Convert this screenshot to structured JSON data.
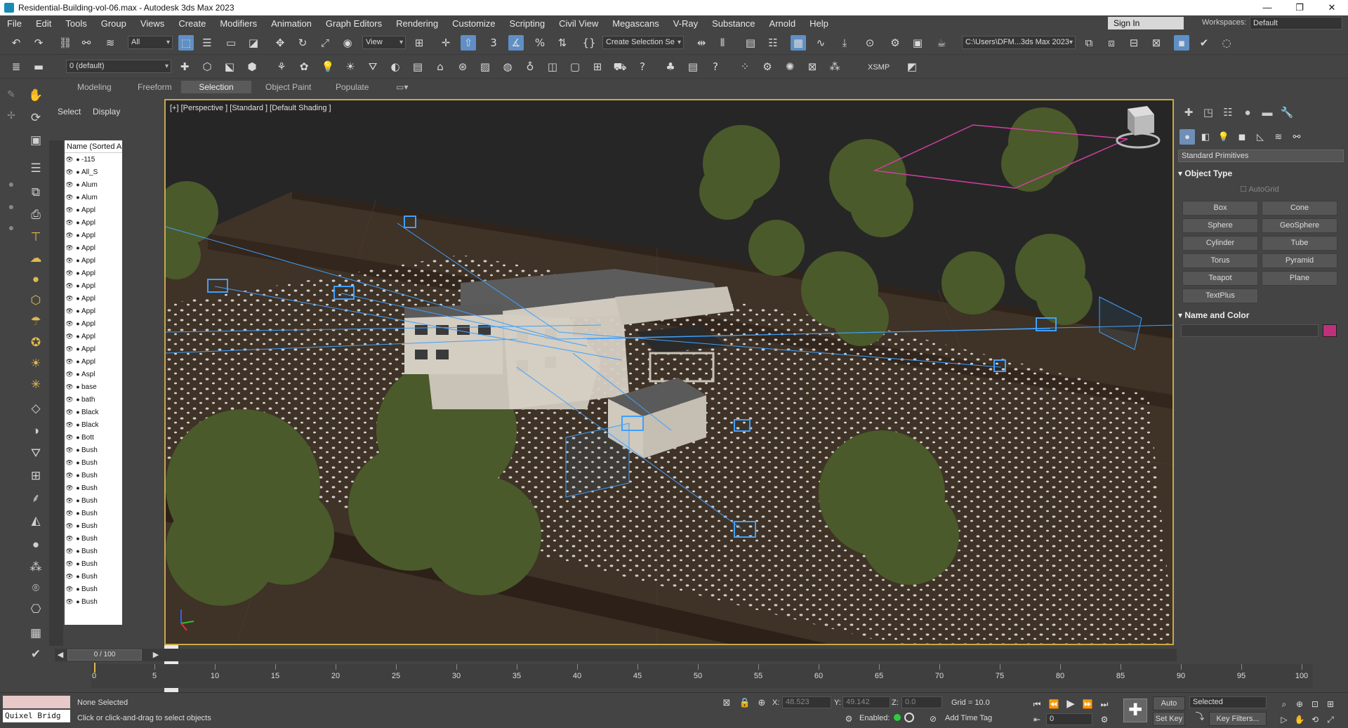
{
  "window": {
    "title": "Residential-Building-vol-06.max - Autodesk 3ds Max 2023",
    "minimize": "—",
    "maximize": "❐",
    "close": "✕"
  },
  "menu": {
    "items": [
      "File",
      "Edit",
      "Tools",
      "Group",
      "Views",
      "Create",
      "Modifiers",
      "Animation",
      "Graph Editors",
      "Rendering",
      "Customize",
      "Scripting",
      "Civil View",
      "Megascans",
      "V-Ray",
      "Substance",
      "Arnold",
      "Help"
    ],
    "sign_in": "Sign In",
    "workspaces_label": "Workspaces:",
    "workspaces_value": "Default"
  },
  "toolbar": {
    "selection_filter": "All",
    "ref_coord": "View",
    "named_selection": "Create Selection Se",
    "project_path": "C:\\Users\\DFM...3ds Max 2023",
    "layer_value": "0 (default)",
    "xsmp_label": "XSMP"
  },
  "ribbon": {
    "tabs": [
      "Modeling",
      "Freeform",
      "Selection",
      "Object Paint",
      "Populate"
    ],
    "active": "Selection"
  },
  "explorer": {
    "tab_select": "Select",
    "tab_display": "Display",
    "column_header": "Name (Sorted Asce",
    "rows": [
      "-115",
      "All_S",
      "Alum",
      "Alum",
      "Appl",
      "Appl",
      "Appl",
      "Appl",
      "Appl",
      "Appl",
      "Appl",
      "Appl",
      "Appl",
      "Appl",
      "Appl",
      "Appl",
      "Appl",
      "Aspl",
      "base",
      "bath",
      "Black",
      "Black",
      "Bott",
      "Bush",
      "Bush",
      "Bush",
      "Bush",
      "Bush",
      "Bush",
      "Bush",
      "Bush",
      "Bush",
      "Bush",
      "Bush",
      "Bush",
      "Bush"
    ]
  },
  "viewport": {
    "label": "[+] [Perspective ] [Standard ] [Default Shading ]"
  },
  "command_panel": {
    "category": "Standard Primitives",
    "object_type_title": "Object Type",
    "autogrid_label": "AutoGrid",
    "primitives": [
      "Box",
      "Cone",
      "Sphere",
      "GeoSphere",
      "Cylinder",
      "Tube",
      "Torus",
      "Pyramid",
      "Teapot",
      "Plane",
      "TextPlus"
    ],
    "name_color_title": "Name and Color",
    "object_color": "#c0307a"
  },
  "timeline": {
    "frame_display": "0 / 100",
    "ticks": [
      "0",
      "5",
      "10",
      "15",
      "20",
      "25",
      "30",
      "35",
      "40",
      "45",
      "50",
      "55",
      "60",
      "65",
      "70",
      "75",
      "80",
      "85",
      "90",
      "95",
      "100"
    ]
  },
  "status": {
    "maxscript_mini": "Quixel Bridg",
    "selection_info": "None Selected",
    "prompt": "Click or click-and-drag to select objects",
    "x_label": "X:",
    "x_value": "48.523",
    "y_label": "Y:",
    "y_value": "49.142",
    "z_label": "Z:",
    "z_value": "0.0",
    "grid": "Grid = 10.0",
    "enabled_label": "Enabled:",
    "add_time_tag": "Add Time Tag",
    "auto_key": "Auto Key",
    "set_key": "Set Key",
    "key_mode": "Selected",
    "key_filters": "Key Filters...",
    "current_frame": "0"
  },
  "colors": {
    "accent": "#5f8fc5",
    "viewport_border": "#c8a84a",
    "ground": "#3f3226",
    "camera_wire": "#3fa0ff",
    "light_box": "#d040a0"
  }
}
